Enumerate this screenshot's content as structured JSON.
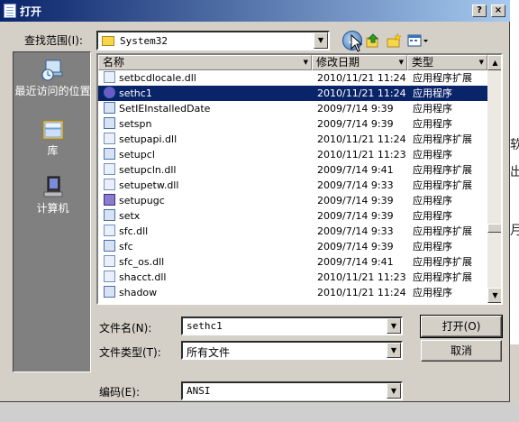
{
  "window": {
    "title": "打开"
  },
  "title_buttons": {
    "help": "?",
    "close": "×"
  },
  "lookin": {
    "label": "查找范围(I):",
    "value": "System32"
  },
  "toolbar": {
    "back_icon": "back-arrow-icon",
    "up_icon": "up-folder-icon",
    "new_folder_icon": "new-folder-icon",
    "views_icon": "views-menu-icon"
  },
  "places": [
    {
      "label": "最近访问的位置",
      "icon": "recent-places-icon"
    },
    {
      "label": "库",
      "icon": "libraries-icon"
    },
    {
      "label": "计算机",
      "icon": "computer-icon"
    }
  ],
  "columns": {
    "name": "名称",
    "date": "修改日期",
    "type": "类型"
  },
  "files": [
    {
      "name": "setbcdlocale.dll",
      "date": "2010/11/21 11:24",
      "type": "应用程序扩展",
      "icon": "dll-icon",
      "selected": false
    },
    {
      "name": "sethc1",
      "date": "2010/11/21 11:24",
      "type": "应用程序",
      "icon": "exe-icon",
      "selected": true
    },
    {
      "name": "SetIEInstalledDate",
      "date": "2009/7/14 9:39",
      "type": "应用程序",
      "icon": "exe-icon",
      "selected": false
    },
    {
      "name": "setspn",
      "date": "2009/7/14 9:39",
      "type": "应用程序",
      "icon": "exe-icon",
      "selected": false
    },
    {
      "name": "setupapi.dll",
      "date": "2010/11/21 11:24",
      "type": "应用程序扩展",
      "icon": "dll-icon",
      "selected": false
    },
    {
      "name": "setupcl",
      "date": "2010/11/21 11:23",
      "type": "应用程序",
      "icon": "exe-icon",
      "selected": false
    },
    {
      "name": "setupcln.dll",
      "date": "2009/7/14 9:41",
      "type": "应用程序扩展",
      "icon": "dll-icon",
      "selected": false
    },
    {
      "name": "setupetw.dll",
      "date": "2009/7/14 9:33",
      "type": "应用程序扩展",
      "icon": "dll-icon",
      "selected": false
    },
    {
      "name": "setupugc",
      "date": "2009/7/14 9:39",
      "type": "应用程序",
      "icon": "setup-icon",
      "selected": false
    },
    {
      "name": "setx",
      "date": "2009/7/14 9:39",
      "type": "应用程序",
      "icon": "exe-icon",
      "selected": false
    },
    {
      "name": "sfc.dll",
      "date": "2009/7/14 9:33",
      "type": "应用程序扩展",
      "icon": "dll-icon",
      "selected": false
    },
    {
      "name": "sfc",
      "date": "2009/7/14 9:39",
      "type": "应用程序",
      "icon": "exe-icon",
      "selected": false
    },
    {
      "name": "sfc_os.dll",
      "date": "2009/7/14 9:41",
      "type": "应用程序扩展",
      "icon": "dll-icon",
      "selected": false
    },
    {
      "name": "shacct.dll",
      "date": "2010/11/21 11:23",
      "type": "应用程序扩展",
      "icon": "dll-icon",
      "selected": false
    },
    {
      "name": "shadow",
      "date": "2010/11/21 11:24",
      "type": "应用程序",
      "icon": "exe-icon",
      "selected": false
    }
  ],
  "filename": {
    "label": "文件名(N):",
    "value": "sethc1"
  },
  "filetype": {
    "label": "文件类型(T):",
    "value": "所有文件"
  },
  "encoding": {
    "label": "编码(E):",
    "value": "ANSI"
  },
  "buttons": {
    "open": "打开(O)",
    "cancel": "取消"
  },
  "background_text": [
    "软",
    "出",
    "月"
  ]
}
